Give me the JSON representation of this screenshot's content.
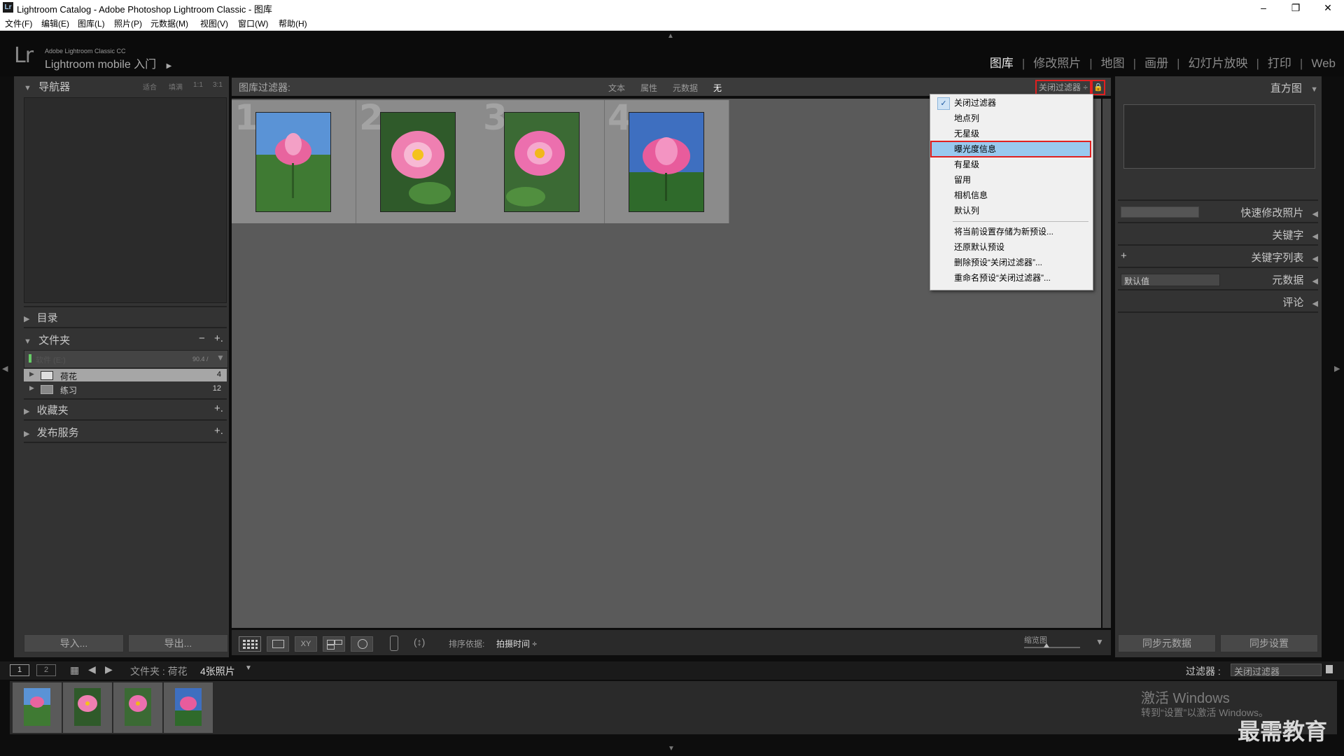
{
  "window": {
    "app_icon": "Lr",
    "title": "Lightroom Catalog - Adobe Photoshop Lightroom Classic - 图库",
    "minimize": "–",
    "restore": "❐",
    "close": "✕"
  },
  "menu": [
    "文件(F)",
    "编辑(E)",
    "图库(L)",
    "照片(P)",
    "元数据(M)",
    "视图(V)",
    "窗口(W)",
    "帮助(H)"
  ],
  "identity": {
    "logo": "Lr",
    "product": "Adobe Lightroom Classic CC",
    "mobile": "Lightroom mobile 入门"
  },
  "modules": [
    "图库",
    "修改照片",
    "地图",
    "画册",
    "幻灯片放映",
    "打印",
    "Web"
  ],
  "left_panel": {
    "navigator": {
      "title": "导航器",
      "zoom": [
        "适合",
        "填满",
        "1:1",
        "3:1"
      ]
    },
    "catalog": "目录",
    "folders": {
      "title": "文件夹",
      "minus": "−",
      "plus": "+.",
      "volume_name": "软件 (E:)",
      "volume_size": "90.4 / ",
      "items": [
        {
          "name": "荷花",
          "count": "4"
        },
        {
          "name": "练习",
          "count": "12"
        }
      ]
    },
    "collections": "收藏夹",
    "publish": "发布服务",
    "import_btn": "导入...",
    "export_btn": "导出..."
  },
  "filter_bar": {
    "label": "图库过滤器:",
    "tabs": [
      "文本",
      "属性",
      "元数据",
      "无"
    ],
    "preset": "关闭过滤器 ÷"
  },
  "grid": {
    "cells": [
      {
        "num": "1",
        "sky": "#5a93d6",
        "flower": "#e8649e"
      },
      {
        "num": "2",
        "sky": "#2f5a2a",
        "flower": "#ef7fb1"
      },
      {
        "num": "3",
        "sky": "#3b6a34",
        "flower": "#ec6fae"
      },
      {
        "num": "4",
        "sky": "#3e6fc0",
        "flower": "#e85c9c"
      }
    ]
  },
  "dropdown": {
    "items": [
      "关闭过滤器",
      "地点列",
      "无星级",
      "曝光度信息",
      "有星级",
      "留用",
      "相机信息",
      "默认列"
    ],
    "actions": [
      "将当前设置存储为新预设...",
      "还原默认预设",
      "删除预设“关闭过滤器”...",
      "重命名预设“关闭过滤器”..."
    ],
    "checked": "关闭过滤器",
    "highlighted": "曝光度信息"
  },
  "right_panel": {
    "histogram": "直方图",
    "quick_develop": "快速修改照片",
    "keywording": "关键字",
    "keyword_list": "关键字列表",
    "keyword_plus": "+",
    "metadata": "元数据",
    "metadata_preset": "默认值",
    "comments": "评论",
    "sync_metadata": "同步元数据",
    "sync_settings": "同步设置"
  },
  "toolbar": {
    "sort_label": "排序依据:",
    "sort_value": "拍摄时间 ÷",
    "thumb_label": "缩览图",
    "compare_label": "XY"
  },
  "filmstrip_bar": {
    "screen1": "1",
    "screen2": "2",
    "source": "文件夹 : 荷花",
    "count": "4张照片",
    "filter_label": "过滤器 :",
    "filter_value": "关闭过滤器"
  },
  "watermark": {
    "activate": "激活 Windows",
    "activate_sub": "转到“设置”以激活 Windows。",
    "brand": "最需教育"
  },
  "colors": {
    "highlight": "#99c9ef",
    "highlight_border": "#e02020",
    "panel": "#333333",
    "grid_bg": "#5a5a5a"
  }
}
